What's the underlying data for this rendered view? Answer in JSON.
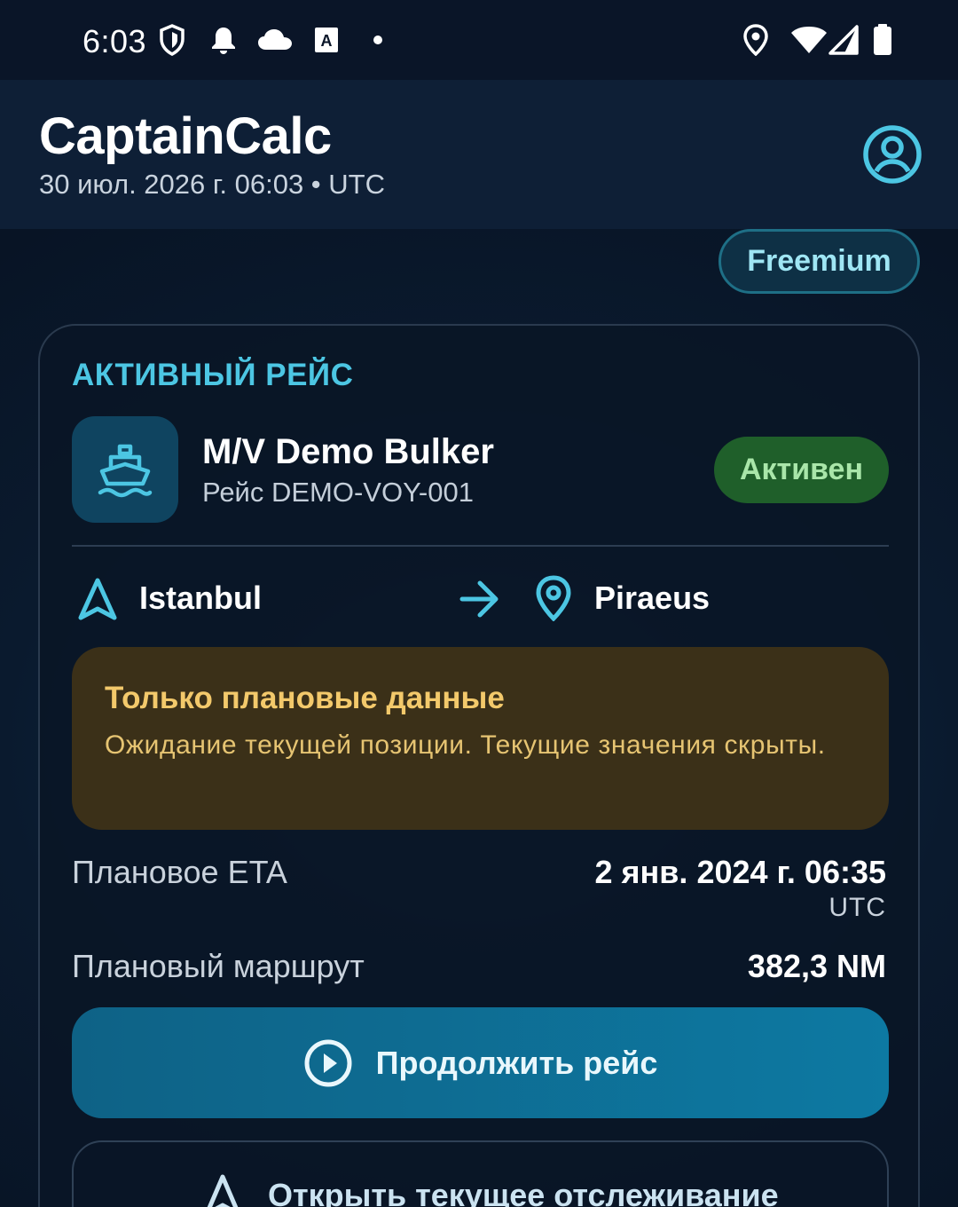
{
  "status_bar": {
    "time": "6:03",
    "left_icons": [
      "shield-icon",
      "bell-icon",
      "cloud-icon",
      "font-a-icon",
      "dot-icon"
    ],
    "right_icons": [
      "location-pin-icon",
      "wifi-icon",
      "signal-icon",
      "battery-icon"
    ]
  },
  "app_bar": {
    "title": "CaptainCalc",
    "subtitle": "30 июл. 2026 г. 06:03 • UTC",
    "profile_icon": "account-circle-icon"
  },
  "plan_chip": {
    "label": "Freemium"
  },
  "voyage_card": {
    "section_label": "АКТИВНЫЙ РЕЙС",
    "ship_icon": "ship-icon",
    "vessel_name": "M/V Demo Bulker",
    "voyage_number": "Рейс DEMO-VOY-001",
    "status": "Активен",
    "route": {
      "from": "Istanbul",
      "to": "Piraeus",
      "from_icon": "navigation-arrow-icon",
      "arrow_icon": "arrow-right-icon",
      "to_icon": "location-pin-icon"
    },
    "warning": {
      "title": "Только плановые данные",
      "text": "Ожидание текущей позиции. Текущие значения скрыты."
    },
    "eta": {
      "label": "Плановое ETA",
      "value": "2 янв. 2024 г. 06:35",
      "unit": "UTC"
    },
    "route_distance": {
      "label": "Плановый маршрут",
      "value": "382,3 NM"
    },
    "continue_button": {
      "label": "Продолжить рейс",
      "icon": "play-circle-icon"
    },
    "tracking_button": {
      "label": "Открыть текущее отслеживание",
      "icon": "navigation-arrow-icon"
    }
  },
  "colors": {
    "accent": "#4cc6e3",
    "background": "#0a1729",
    "app_bar": "#0e1f36",
    "status_active_bg": "#1f5f2a",
    "status_active_text": "#a9e6a9",
    "warning_bg": "#3b3018",
    "warning_text": "#f3c96b",
    "primary_button": "#0d79a2"
  }
}
